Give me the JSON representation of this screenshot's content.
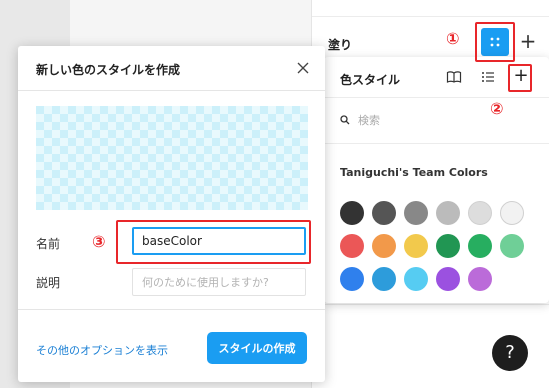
{
  "fill_panel": {
    "label": "塗り",
    "style_button_icon": "grid-dots-icon",
    "add_label": "+"
  },
  "annotations": {
    "one": "①",
    "two": "②",
    "three": "③",
    "highlight_color": "#e8262a"
  },
  "color_styles_popover": {
    "title": "色スタイル",
    "library_icon": "book-icon",
    "list_view_icon": "list-icon",
    "add_label": "+",
    "search": {
      "icon": "search-icon",
      "placeholder": "検索",
      "value": ""
    },
    "library_title": "Taniguchi's Team Colors",
    "swatches": [
      "#333333",
      "#555555",
      "#888888",
      "#bbbbbb",
      "#dddddd",
      "#f2f2f2",
      "#eb5757",
      "#f2994a",
      "#f2c94c",
      "#219653",
      "#27ae60",
      "#6fcf97",
      "#2f80ed",
      "#2d9cdb",
      "#56ccf2",
      "#9b51e0",
      "#bb6bd9"
    ]
  },
  "create_style_dialog": {
    "title": "新しい色のスタイルを作成",
    "close_icon": "close-icon",
    "preview_background": "checkerboard",
    "name": {
      "label": "名前",
      "value": "baseColor"
    },
    "description": {
      "label": "説明",
      "placeholder": "何のために使用しますか?",
      "value": ""
    },
    "more_options_label": "その他のオプションを表示",
    "create_button_label": "スタイルの作成"
  },
  "help_button": {
    "label": "?"
  },
  "colors": {
    "accent": "#1a9df2",
    "link": "#1a7fd4"
  }
}
